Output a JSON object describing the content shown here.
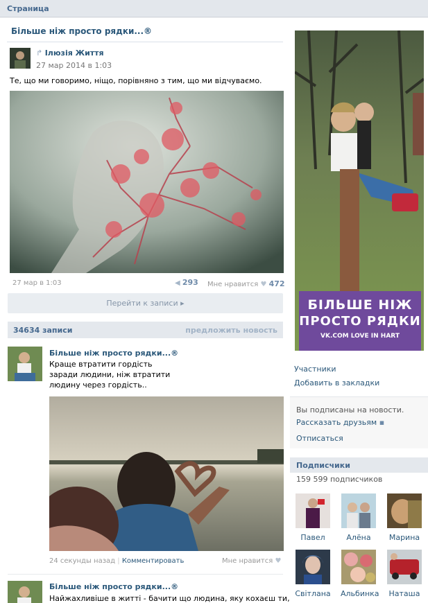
{
  "topbar": {
    "title": "Страница"
  },
  "pinned": {
    "title": "Більше ніж просто рядки...®",
    "author": "Ілюзія Життя",
    "date": "27 мар 2014 в 1:03",
    "text": "Те, що ми говоримо, ніщо, порівняно з тим, що ми відчуваємо.",
    "footer_date": "27 мар в 1:03",
    "reposts": "293",
    "likes_label": "Мне нравится",
    "likes": "472",
    "goto_label": "Перейти к записи ▸"
  },
  "wall": {
    "count": "34634 записи",
    "suggest": "предложить новость"
  },
  "posts": [
    {
      "author": "Більше ніж просто рядки...®",
      "lines": [
        "Краще втратити гордість",
        "заради людини, ніж втратити",
        "людину через гордість.."
      ],
      "time": "24 секунды назад",
      "separator": "|",
      "comment": "Комментировать",
      "likes_label": "Мне нравится"
    },
    {
      "author": "Більше ніж просто рядки...®",
      "text": "Найжахливіше в житті - бачити що людина, яку кохаєш ти,"
    }
  ],
  "sidebar": {
    "banner": {
      "line1": "БІЛЬШЕ НІЖ",
      "line2": "ПРОСТО РЯДКИ",
      "line3": "VK.COM LOVE IN HART"
    },
    "members_link": "Участники",
    "bookmark_link": "Добавить в закладки",
    "subscribed_text": "Вы подписаны на новости.",
    "tell_friends": "Рассказать друзьям",
    "unsubscribe": "Отписаться",
    "subscribers_title": "Подписчики",
    "subscribers_count": "159 599 подписчиков",
    "members": [
      {
        "name": "Павел"
      },
      {
        "name": "Алёна"
      },
      {
        "name": "Марина"
      },
      {
        "name": "Світлана"
      },
      {
        "name": "Альбинка"
      },
      {
        "name": "Наташа"
      }
    ]
  },
  "colors": {
    "link": "#2b587a",
    "header": "#45688e",
    "banner_bg": "#6f4a9c"
  },
  "icons": {
    "repost": "megaphone-icon",
    "like": "heart-icon",
    "arrow": "chevron-right-icon",
    "share": "speech-bubble-icon"
  }
}
